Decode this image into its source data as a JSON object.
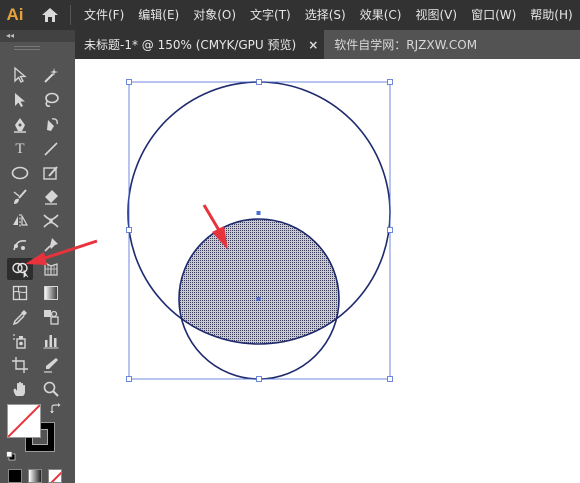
{
  "app": {
    "logo": "Ai",
    "home_icon": "home-icon"
  },
  "menu": [
    {
      "label": "文件(F)"
    },
    {
      "label": "编辑(E)"
    },
    {
      "label": "对象(O)"
    },
    {
      "label": "文字(T)"
    },
    {
      "label": "选择(S)"
    },
    {
      "label": "效果(C)"
    },
    {
      "label": "视图(V)"
    },
    {
      "label": "窗口(W)"
    },
    {
      "label": "帮助(H)"
    }
  ],
  "tabs": {
    "active": {
      "title": "未标题-1* @ 150% (CMYK/GPU 预览)",
      "close": "×"
    },
    "inactive": {
      "title": "软件自学网：RJZXW.COM"
    }
  },
  "tools_panel": {
    "collapse_label": "◂◂",
    "type_tool_glyph": "T",
    "selected_tool": "shape-builder-tool"
  },
  "colors": {
    "menu_bg": "#323232",
    "panel_bg": "#535353",
    "logo": "#e7a33a",
    "selection": "#4a6cd4",
    "circle_stroke": "#1e2a6e",
    "arrow": "#e8323c",
    "fill_pattern": "#3a3a5a"
  }
}
